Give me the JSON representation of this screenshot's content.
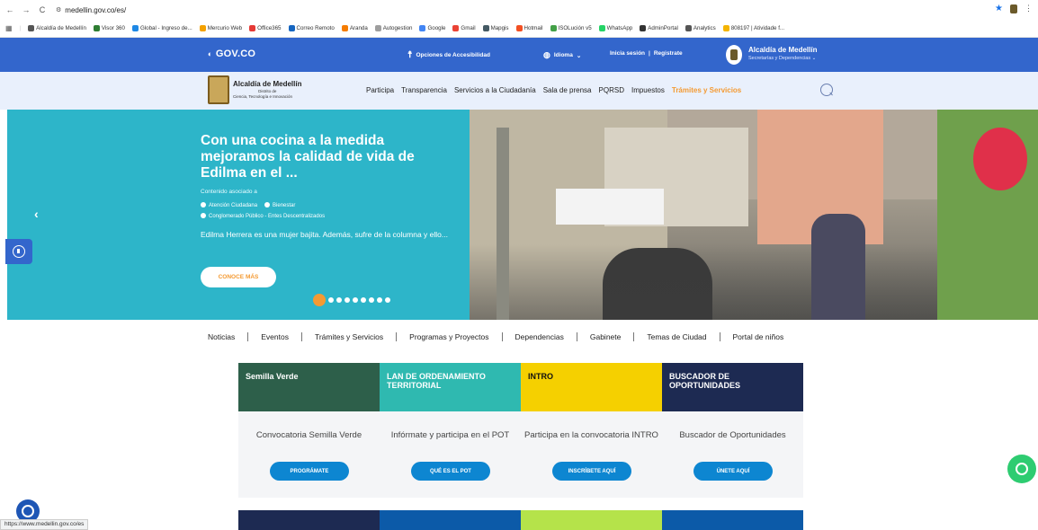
{
  "browser": {
    "url": "medellin.gov.co/es/",
    "status_url": "https://www.medellin.gov.co/es"
  },
  "bookmarks": [
    {
      "label": "Alcaldía de Medellín",
      "color": "#555"
    },
    {
      "label": "Visor 360",
      "color": "#2e7d32"
    },
    {
      "label": "Global - Ingreso de...",
      "color": "#1e88e5"
    },
    {
      "label": "Mercurio Web",
      "color": "#f4a100"
    },
    {
      "label": "Office365",
      "color": "#e53935"
    },
    {
      "label": "Correo Remoto",
      "color": "#1565c0"
    },
    {
      "label": "Aranda",
      "color": "#f57c00"
    },
    {
      "label": "Autogestion",
      "color": "#9e9e9e"
    },
    {
      "label": "Google",
      "color": "#4285f4"
    },
    {
      "label": "Gmail",
      "color": "#ea4335"
    },
    {
      "label": "Mapgis",
      "color": "#455a64"
    },
    {
      "label": "Hotmail",
      "color": "#f25022"
    },
    {
      "label": "ISOLución v5",
      "color": "#43a047"
    },
    {
      "label": "WhatsApp",
      "color": "#25d366"
    },
    {
      "label": "AdminPortal",
      "color": "#333"
    },
    {
      "label": "Analytics",
      "color": "#555"
    },
    {
      "label": "808197 | Atividade f...",
      "color": "#f4b400"
    }
  ],
  "gov_bar": {
    "logo": "GOV.CO",
    "accessibility": "Opciones de Accesibilidad",
    "language": "Idioma",
    "login": "Inicia sesión",
    "separator": "|",
    "register": "Registrate",
    "alcaldia_title": "Alcaldía de Medellín",
    "alcaldia_sub": "Secretarías y Dependencias"
  },
  "site_nav": {
    "logo_title": "Alcaldía de Medellín",
    "logo_sub1": "Distrito de",
    "logo_sub2": "Ciencia, Tecnología e Innovación",
    "items": [
      {
        "label": "Participa"
      },
      {
        "label": "Transparencia"
      },
      {
        "label": "Servicios a la Ciudadanía"
      },
      {
        "label": "Sala de prensa"
      },
      {
        "label": "PQRSD"
      },
      {
        "label": "Impuestos"
      },
      {
        "label": "Trámites y Servicios"
      }
    ]
  },
  "hero": {
    "title": "Con una cocina a la medida mejoramos la calidad de vida de Edilma en el ...",
    "associated": "Contenido asociado a",
    "tags": [
      "Atención Ciudadana",
      "Bienestar",
      "Conglomerado Público - Entes Descentralizados"
    ],
    "description": "Edilma Herrera es una mujer bajita. Además, sufre de la columna y ello...",
    "button": "CONOCE MÁS"
  },
  "secondary_nav": [
    {
      "label": "Noticias"
    },
    {
      "label": "Eventos"
    },
    {
      "label": "Trámites y Servicios"
    },
    {
      "label": "Programas y Proyectos"
    },
    {
      "label": "Dependencias"
    },
    {
      "label": "Gabinete"
    },
    {
      "label": "Temas de Ciudad"
    },
    {
      "label": "Portal de niños"
    }
  ],
  "cards": [
    {
      "title": "Convocatoria Semilla Verde",
      "button": "PROGRÁMATE",
      "img_color": "#2d5f4a",
      "img_text": "Semilla Verde"
    },
    {
      "title": "Infórmate y participa en el POT",
      "button": "QUÉ ES EL POT",
      "img_color": "#2fb9b0",
      "img_text": "LAN DE ORDENAMIENTO TERRITORIAL"
    },
    {
      "title": "Participa en la convocatoria INTRO",
      "button": "INSCRÍBETE AQUÍ",
      "img_color": "#f5d000",
      "img_text": "INTRO"
    },
    {
      "title": "Buscador de Oportunidades",
      "button": "ÚNETE AQUÍ",
      "img_color": "#1d2a52",
      "img_text": "BUSCADOR DE OPORTUNIDADES"
    }
  ],
  "colors": {
    "gov_blue": "#3366cc",
    "accent_orange": "#f49a32",
    "hero_teal": "#2db5c9",
    "button_blue": "#0d86d1"
  }
}
